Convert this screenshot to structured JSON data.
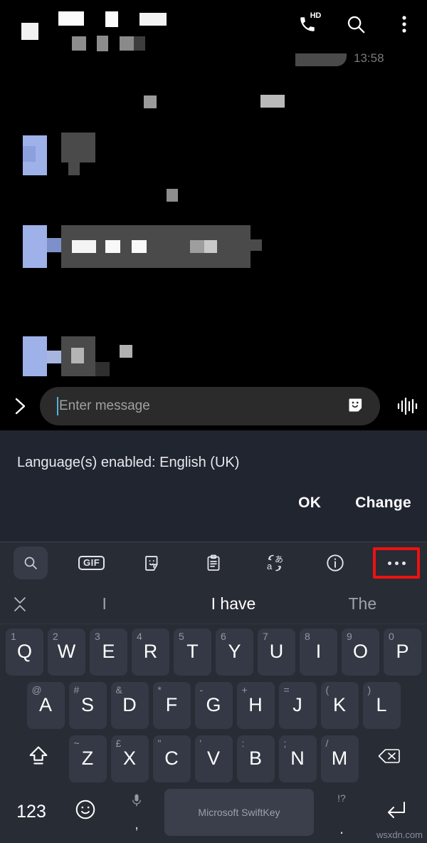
{
  "app": {
    "header": {
      "call_icon": "phone-hd-icon",
      "hd_label": "HD",
      "search_icon": "search-icon",
      "overflow_icon": "more-vertical-icon"
    },
    "chat": {
      "timestamp_partial": "13:58",
      "redacted_note": "message content obscured"
    },
    "composer": {
      "expand_icon": "chevron-right-icon",
      "placeholder": "Enter message",
      "value": "",
      "sticker_icon": "sticker-icon",
      "voice_icon": "audio-waveform-icon"
    }
  },
  "language_notice": {
    "text": "Language(s) enabled: English (UK)",
    "ok_label": "OK",
    "change_label": "Change"
  },
  "keyboard": {
    "toolbar": [
      {
        "name": "search-icon",
        "label": "",
        "active": true,
        "boxed": false
      },
      {
        "name": "gif-icon",
        "label": "GIF",
        "active": false,
        "boxed": false
      },
      {
        "name": "sticker-icon",
        "label": "",
        "active": false,
        "boxed": false
      },
      {
        "name": "clipboard-icon",
        "label": "",
        "active": false,
        "boxed": false
      },
      {
        "name": "translate-icon",
        "label": "",
        "active": false,
        "boxed": false
      },
      {
        "name": "info-icon",
        "label": "",
        "active": false,
        "boxed": false
      },
      {
        "name": "more-horizontal-icon",
        "label": "",
        "active": false,
        "boxed": true
      }
    ],
    "highlight_color": "#ee1111",
    "predictions": {
      "collapse_icon": "collapse-chevrons-icon",
      "items": [
        {
          "text": "I",
          "selected": false
        },
        {
          "text": "I have",
          "selected": true
        },
        {
          "text": "The",
          "selected": false
        }
      ]
    },
    "rows": {
      "row1": [
        {
          "key": "Q",
          "alt": "1"
        },
        {
          "key": "W",
          "alt": "2"
        },
        {
          "key": "E",
          "alt": "3"
        },
        {
          "key": "R",
          "alt": "4"
        },
        {
          "key": "T",
          "alt": "5"
        },
        {
          "key": "Y",
          "alt": "6"
        },
        {
          "key": "U",
          "alt": "7"
        },
        {
          "key": "I",
          "alt": "8"
        },
        {
          "key": "O",
          "alt": "9"
        },
        {
          "key": "P",
          "alt": "0"
        }
      ],
      "row2": [
        {
          "key": "A",
          "alt": "@"
        },
        {
          "key": "S",
          "alt": "#"
        },
        {
          "key": "D",
          "alt": "&"
        },
        {
          "key": "F",
          "alt": "*"
        },
        {
          "key": "G",
          "alt": "-"
        },
        {
          "key": "H",
          "alt": "+"
        },
        {
          "key": "J",
          "alt": "="
        },
        {
          "key": "K",
          "alt": "("
        },
        {
          "key": "L",
          "alt": ")"
        }
      ],
      "row3": [
        {
          "key": "Z",
          "alt": "~"
        },
        {
          "key": "X",
          "alt": "£"
        },
        {
          "key": "C",
          "alt": "\""
        },
        {
          "key": "V",
          "alt": "'"
        },
        {
          "key": "B",
          "alt": ":"
        },
        {
          "key": "N",
          "alt": ";"
        },
        {
          "key": "M",
          "alt": "/"
        }
      ],
      "shift_icon": "shift-icon",
      "backspace_icon": "backspace-icon",
      "numeric_label": "123",
      "emoji_icon": "emoji-icon",
      "comma_label": ",",
      "comma_alt_icon": "microphone-icon",
      "space_label": "Microsoft SwiftKey",
      "period_label": ".",
      "period_alt": "!?",
      "enter_icon": "enter-icon"
    }
  },
  "watermark": {
    "text": "wsxdn.com"
  }
}
